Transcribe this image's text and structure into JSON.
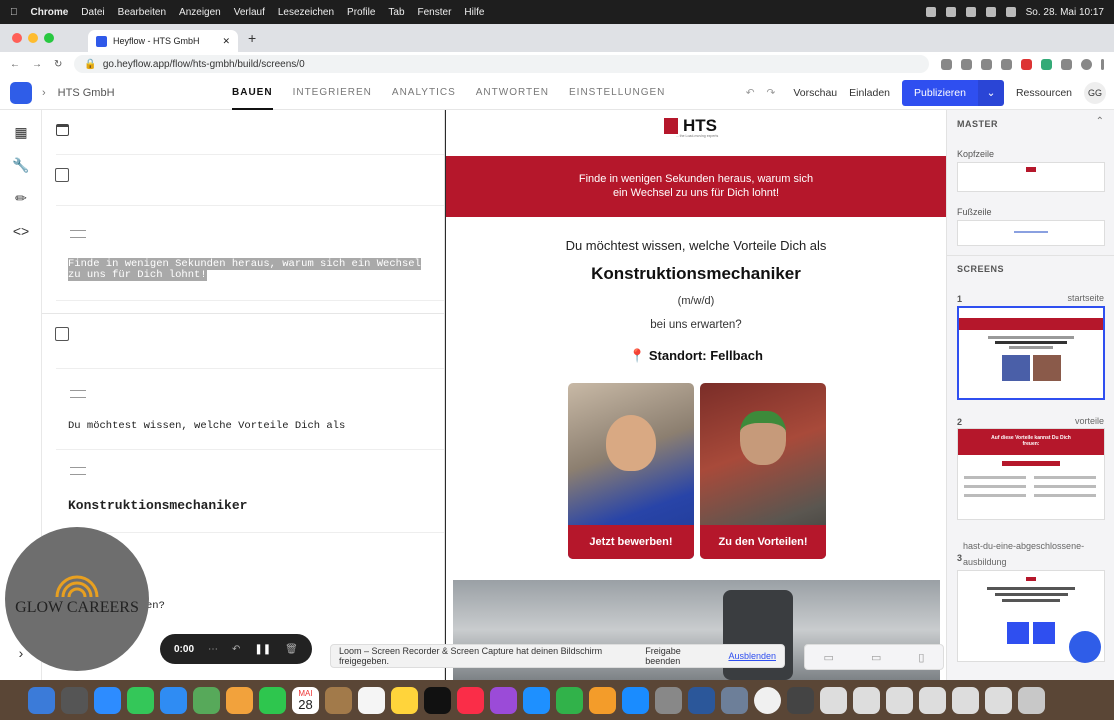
{
  "menubar": {
    "app": "Chrome",
    "items": [
      "Datei",
      "Bearbeiten",
      "Anzeigen",
      "Verlauf",
      "Lesezeichen",
      "Profile",
      "Tab",
      "Fenster",
      "Hilfe"
    ],
    "datetime": "So. 28. Mai  10:17"
  },
  "browser": {
    "tab_title": "Heyflow - HTS GmbH",
    "url": "go.heyflow.app/flow/hts-gmbh/build/screens/0"
  },
  "header": {
    "crumb": "HTS GmbH",
    "tabs": [
      "BAUEN",
      "INTEGRIEREN",
      "ANALYTICS",
      "ANTWORTEN",
      "EINSTELLUNGEN"
    ],
    "active_tab": "BAUEN",
    "preview": "Vorschau",
    "invite": "Einladen",
    "publish": "Publizieren",
    "resources": "Ressourcen",
    "avatar": "GG",
    "accent": "#2f4ff0"
  },
  "editor": {
    "block1_text": "Finde in wenigen Sekunden heraus, warum sich ein Wechsel zu uns für Dich lohnt!",
    "block2_text": "Du möchtest wissen, welche Vorteile Dich als",
    "block3_text": "Konstruktionsmechaniker",
    "block4_text": "en?"
  },
  "preview": {
    "logo": "HTS",
    "logo_tag": "... the Load-moving experts",
    "banner_line1": "Finde in wenigen Sekunden heraus, warum sich",
    "banner_line2": "ein Wechsel zu uns für Dich lohnt!",
    "intro": "Du möchtest wissen, welche Vorteile Dich als",
    "job": "Konstruktionsmechaniker",
    "gender": "(m/w/d)",
    "expect": "bei uns erwarten?",
    "location": "Standort: Fellbach",
    "btn_apply": "Jetzt bewerben!",
    "btn_benefits": "Zu den Vorteilen!",
    "brand_color": "#b5172b"
  },
  "master": {
    "title": "MASTER",
    "header_label": "Kopfzeile",
    "footer_label": "Fußzeile",
    "screens_title": "SCREENS",
    "screens": [
      {
        "num": "1",
        "name": "startseite"
      },
      {
        "num": "2",
        "name": "vorteile"
      },
      {
        "num": "3",
        "name": "hast-du-eine-abgeschlossene-ausbildung"
      }
    ],
    "thumb2_title": "Auf diese Vorteile kannst Du Dich freuen:"
  },
  "overlays": {
    "glow_logo": "GLOW CAREERS",
    "recorder_time": "0:00",
    "share_msg": "Loom – Screen Recorder & Screen Capture hat deinen Bildschirm freigegeben.",
    "share_stop": "Freigabe beenden",
    "share_hide": "Ausblenden"
  },
  "dock": {
    "calendar_month": "MAI",
    "calendar_day": "28"
  }
}
